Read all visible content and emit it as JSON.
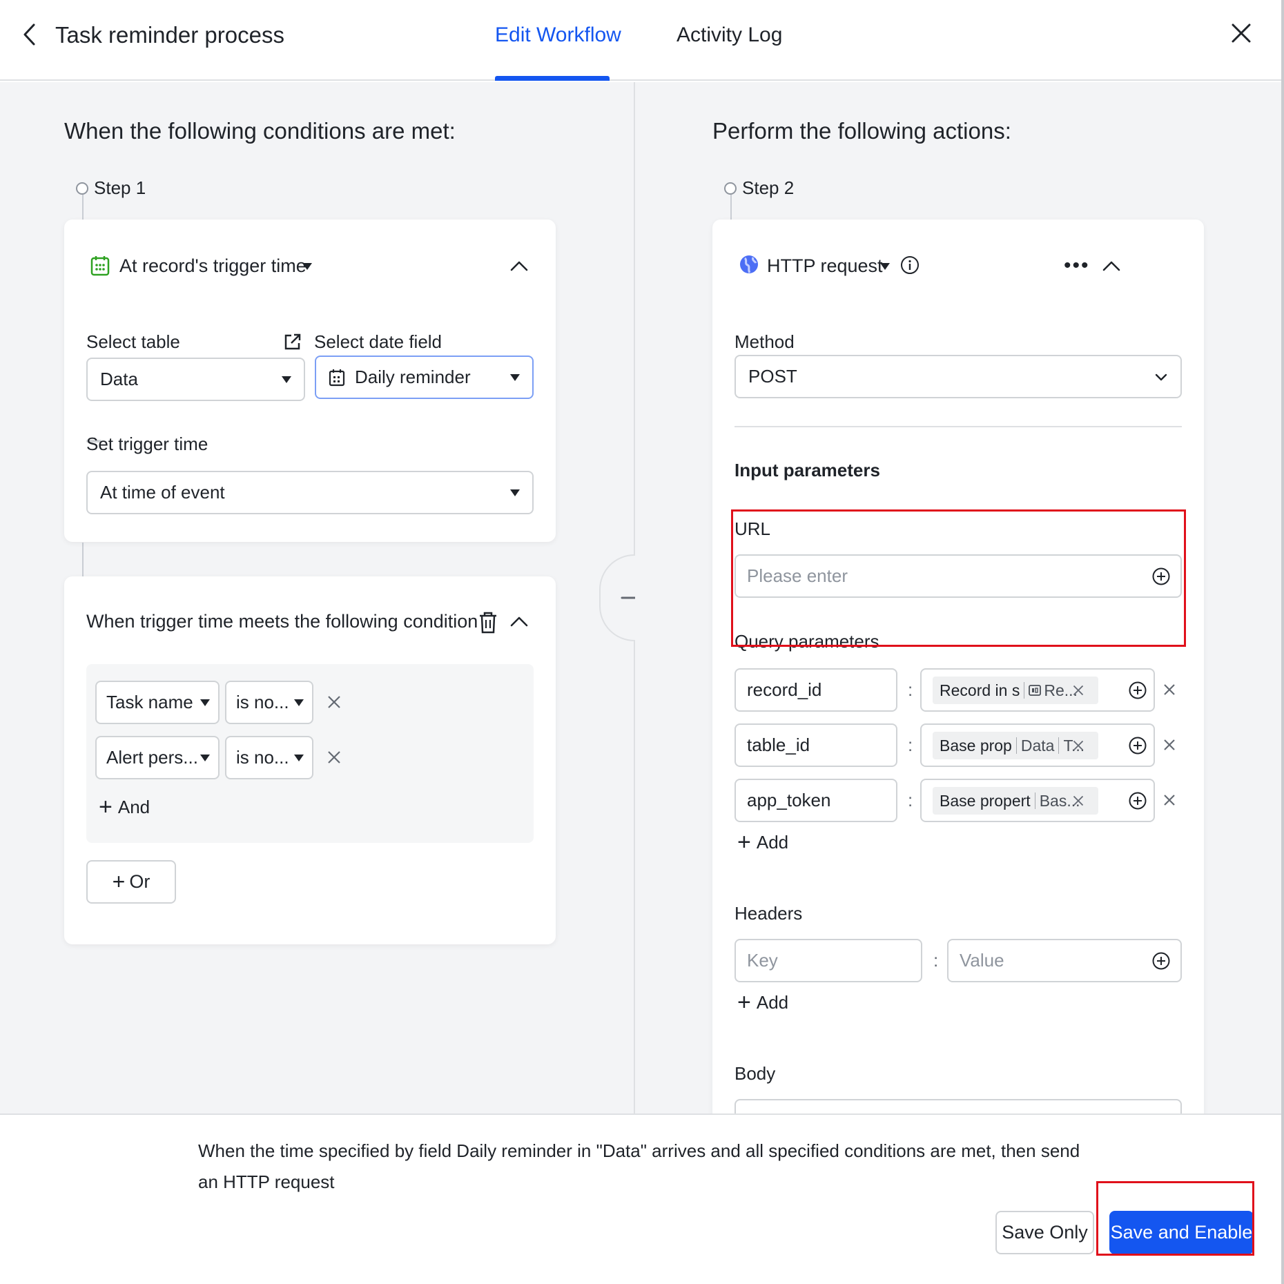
{
  "header": {
    "title": "Task reminder process",
    "tabs": [
      {
        "label": "Edit Workflow",
        "active": true
      },
      {
        "label": "Activity Log",
        "active": false
      }
    ]
  },
  "left": {
    "heading": "When the following conditions are met:",
    "step_label": "Step 1",
    "trigger": {
      "title": "At record's trigger time",
      "select_table_label": "Select table",
      "select_date_field_label": "Select date field",
      "table_value": "Data",
      "date_field_value": "Daily reminder",
      "set_trigger_time_label": "Set trigger time",
      "trigger_time_value": "At time of event"
    },
    "condition": {
      "title": "When trigger time meets the following condition",
      "rows": [
        {
          "field": "Task name",
          "operator": "is no..."
        },
        {
          "field": "Alert pers...",
          "operator": "is no..."
        }
      ],
      "and_label": "And",
      "or_label": "Or"
    }
  },
  "right": {
    "heading": "Perform the following actions:",
    "step_label": "Step 2",
    "action": {
      "title": "HTTP request",
      "method_label": "Method",
      "method_value": "POST",
      "input_params_label": "Input parameters",
      "url_label": "URL",
      "url_placeholder": "Please enter",
      "query_params_label": "Query parameters",
      "query_params": [
        {
          "key": "record_id",
          "tag_main": "Record in s",
          "tag_extra": "Re..."
        },
        {
          "key": "table_id",
          "tag_main": "Base prop",
          "tag_extra": "Data",
          "tag_extra2": "T..."
        },
        {
          "key": "app_token",
          "tag_main": "Base propert",
          "tag_extra": "Bas..."
        }
      ],
      "add_label": "Add",
      "headers_label": "Headers",
      "header_key_placeholder": "Key",
      "header_value_placeholder": "Value",
      "body_label": "Body"
    }
  },
  "footer": {
    "summary": "When the time specified by field Daily reminder in \"Data\" arrives and all specified conditions are met, then send an HTTP request",
    "save_only_label": "Save Only",
    "save_enable_label": "Save and Enable"
  },
  "colors": {
    "accent": "#1456f0",
    "highlight": "#e0101b",
    "background": "#f3f4f6"
  }
}
